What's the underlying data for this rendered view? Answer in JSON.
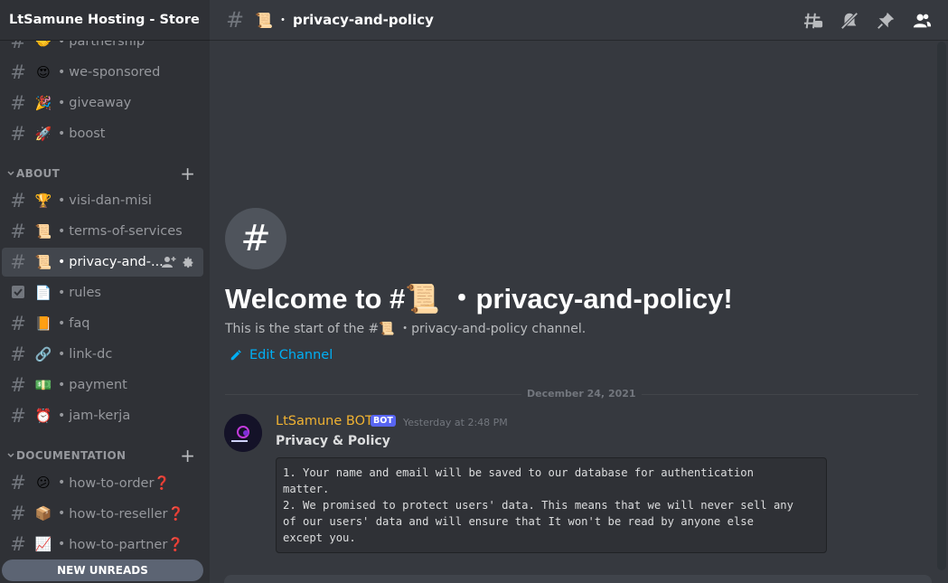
{
  "guild": {
    "name": "LtSamune Hosting - Store"
  },
  "sidebar": {
    "top_channels": [
      {
        "emoji": "🤝",
        "label": "partnership"
      },
      {
        "emoji": "😍",
        "label": "we-sponsored"
      },
      {
        "emoji": "🎉",
        "label": "giveaway"
      },
      {
        "emoji": "🚀",
        "label": "boost"
      }
    ],
    "about": {
      "label": "ABOUT",
      "channels": [
        {
          "emoji": "🏆",
          "label": "visi-dan-misi"
        },
        {
          "emoji": "📜",
          "label": "terms-of-services"
        },
        {
          "emoji": "📜",
          "label": "privacy-and-..."
        },
        {
          "emoji": "📄",
          "label": "rules"
        },
        {
          "emoji": "📙",
          "label": "faq"
        },
        {
          "emoji": "🔗",
          "label": "link-dc"
        },
        {
          "emoji": "💵",
          "label": "payment"
        },
        {
          "emoji": "⏰",
          "label": "jam-kerja"
        }
      ]
    },
    "documentation": {
      "label": "DOCUMENTATION",
      "channels": [
        {
          "emoji": "😕",
          "label": "how-to-order❓"
        },
        {
          "emoji": "📦",
          "label": "how-to-reseller❓"
        },
        {
          "emoji": "📈",
          "label": "how-to-partner❓"
        }
      ]
    },
    "new_unreads": "NEW UNREADS"
  },
  "topbar": {
    "emoji": "📜",
    "dot": "・",
    "title": "privacy-and-policy"
  },
  "welcome": {
    "title": "Welcome to #📜 ・privacy-and-policy!",
    "subtitle": "This is the start of the #📜 ・privacy-and-policy channel.",
    "edit_label": "Edit Channel"
  },
  "divider_date": "December 24, 2021",
  "message": {
    "author": "LtSamune BOT",
    "bot_tag": "BOT",
    "time": "Yesterday at 2:48 PM",
    "heading": "Privacy & Policy",
    "code": "1. Your name and email will be saved to our database for authentication\nmatter.\n2. We promised to protect users' data. This means that we will never sell any\nof our users' data and will ensure that It won't be read by anyone else\nexcept you."
  },
  "colors": {
    "accent": "#00aff4",
    "author": "#f0b232",
    "bot_tag": "#5865f2"
  }
}
